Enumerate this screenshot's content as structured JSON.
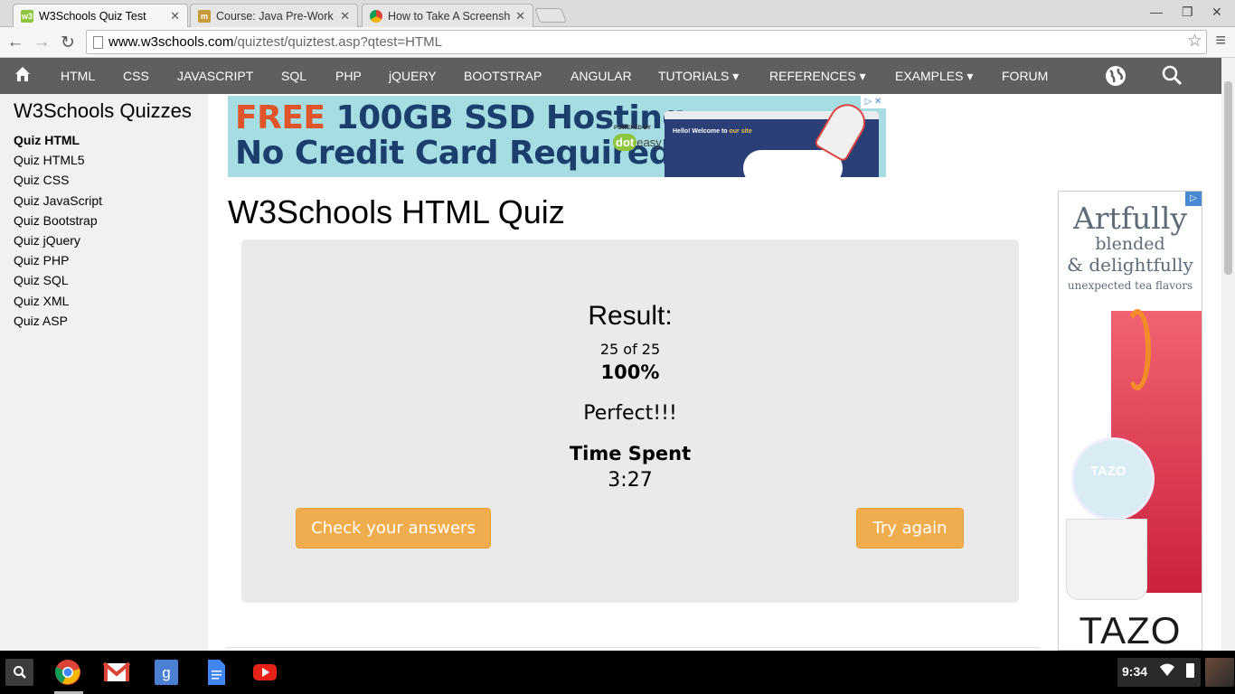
{
  "browser": {
    "tabs": [
      {
        "title": "W3Schools Quiz Test",
        "favicon": "w3",
        "active": true
      },
      {
        "title": "Course: Java Pre-Work S",
        "favicon": "course"
      },
      {
        "title": "How to Take A Screensh",
        "favicon": "chrome"
      }
    ],
    "url_host": "www.w3schools.com",
    "url_path": "/quiztest/quiztest.asp?qtest=HTML"
  },
  "nav": {
    "items": [
      "HTML",
      "CSS",
      "JAVASCRIPT",
      "SQL",
      "PHP",
      "jQUERY",
      "BOOTSTRAP",
      "ANGULAR",
      "TUTORIALS ▾",
      "REFERENCES ▾",
      "EXAMPLES ▾",
      "FORUM"
    ]
  },
  "sidebar": {
    "title": "W3Schools Quizzes",
    "items": [
      "Quiz HTML",
      "Quiz HTML5",
      "Quiz CSS",
      "Quiz JavaScript",
      "Quiz Bootstrap",
      "Quiz jQuery",
      "Quiz PHP",
      "Quiz SQL",
      "Quiz XML",
      "Quiz ASP"
    ],
    "active_index": 0
  },
  "ad_top": {
    "free": "FREE",
    "line1_rest": "100GB SSD Hosting",
    "line2": "No Credit Card Required",
    "powered": "POWERED BY",
    "brand_dot": "dot",
    "brand_rest": "easy",
    "mock_hello": "Hello! Welcome to",
    "mock_site": "our site"
  },
  "main": {
    "title": "W3Schools HTML Quiz",
    "result_label": "Result:",
    "score_text": "25 of 25",
    "percent": "100%",
    "verdict": "Perfect!!!",
    "time_label": "Time Spent",
    "time_value": "3:27",
    "check_button": "Check your answers",
    "retry_button": "Try again"
  },
  "ad_right": {
    "line1": "Artfully",
    "line2": "blended",
    "line3": "& delightfully",
    "line4": "unexpected tea flavors",
    "pod_label": "TAZO",
    "brand": "TAZO"
  },
  "shelf": {
    "clock": "9:34",
    "apps": [
      "chrome-icon",
      "gmail-icon",
      "google-search-icon",
      "docs-icon",
      "youtube-icon"
    ]
  },
  "colors": {
    "nav_bg": "#5f5f5f",
    "sidebar_bg": "#f1f1f1",
    "quiz_box_bg": "#eaeaea",
    "button_orange": "#f0ad4e"
  }
}
